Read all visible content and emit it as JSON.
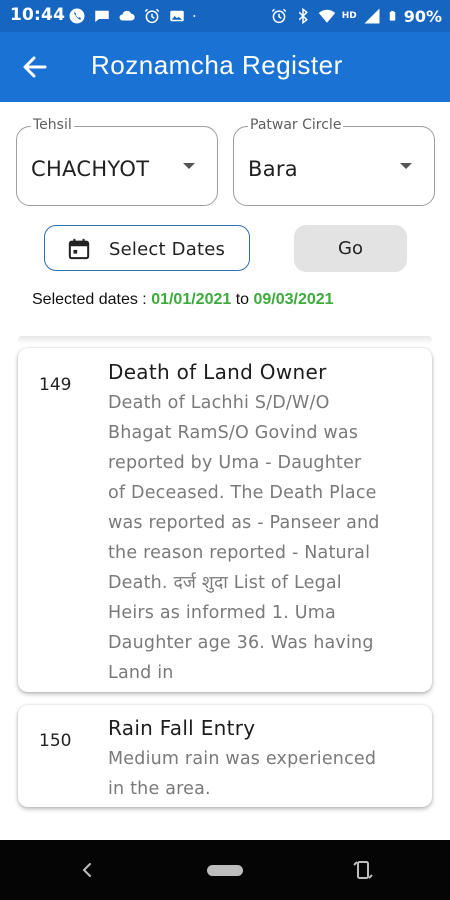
{
  "status_bar": {
    "time": "10:44",
    "network_label": "HD",
    "battery_text": "90%",
    "left_icons": [
      "phone-icon",
      "chat-icon",
      "cloud-icon",
      "alarm-icon",
      "photo-icon",
      "dot-icon"
    ],
    "right_icons": [
      "alarm-icon",
      "bluetooth-icon",
      "wifi-icon",
      "signal-icon",
      "battery-icon"
    ]
  },
  "app_bar": {
    "back_icon": "arrow-back-icon",
    "title": "Roznamcha Register",
    "color": "#1a73d4"
  },
  "filters": {
    "tehsil": {
      "label": "Tehsil",
      "value": "CHACHYOT"
    },
    "patwar_circle": {
      "label": "Patwar Circle",
      "value": "Bara"
    }
  },
  "actions": {
    "select_dates_label": "Select Dates",
    "go_label": "Go"
  },
  "selected_dates": {
    "prefix": "Selected dates : ",
    "from": "01/01/2021",
    "connector": " to ",
    "to": "09/03/2021",
    "date_color": "#3cab3c"
  },
  "entries": [
    {
      "number": "149",
      "title": "Death of Land Owner",
      "body_lines": [
        "Death of Lachhi S/D/W/O",
        "Bhagat RamS/O Govind  was",
        "reported by Uma  - Daughter",
        "of Deceased. The Death Place",
        "was reported as - Panseer  and",
        "the reason reported - Natural",
        "Death. दर्ज शुदा  List of Legal",
        "Heirs as informed 1. Uma",
        "Daughter age 36.  Was having",
        "Land in"
      ]
    },
    {
      "number": "150",
      "title": "Rain Fall Entry",
      "body_lines": [
        "Medium rain was experienced",
        "in the area."
      ]
    }
  ]
}
